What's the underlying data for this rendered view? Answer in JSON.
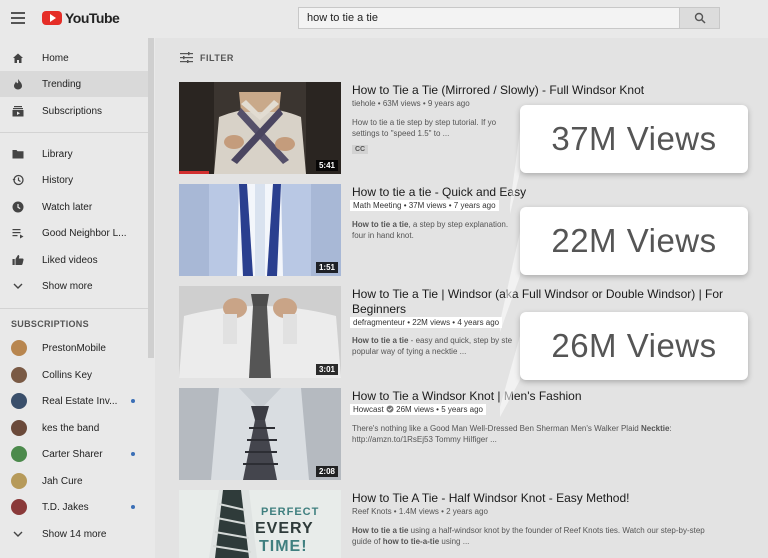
{
  "app": {
    "logo": "YouTube"
  },
  "search": {
    "query": "how to tie a tie"
  },
  "sidebar": {
    "items": [
      {
        "label": "Home",
        "icon": "home-icon"
      },
      {
        "label": "Trending",
        "icon": "trending-icon"
      },
      {
        "label": "Subscriptions",
        "icon": "subscriptions-icon"
      },
      {
        "label": "Library",
        "icon": "library-icon"
      },
      {
        "label": "History",
        "icon": "history-icon"
      },
      {
        "label": "Watch later",
        "icon": "watch-later-icon"
      },
      {
        "label": "Good Neighbor L...",
        "icon": "playlist-icon"
      },
      {
        "label": "Liked videos",
        "icon": "thumbs-up-icon"
      },
      {
        "label": "Show more",
        "icon": "chevron-down-icon"
      }
    ],
    "subscriptions_heading": "SUBSCRIPTIONS",
    "subscriptions": [
      {
        "name": "PrestonMobile",
        "color": "#b8864f",
        "new": false
      },
      {
        "name": "Collins Key",
        "color": "#7a5a45",
        "new": false
      },
      {
        "name": "Real Estate Inv...",
        "color": "#3a4f6b",
        "new": true
      },
      {
        "name": "kes the band",
        "color": "#6b4a3a",
        "new": false
      },
      {
        "name": "Carter Sharer",
        "color": "#4c8a4c",
        "new": true
      },
      {
        "name": "Jah Cure",
        "color": "#b69a5a",
        "new": false
      },
      {
        "name": "T.D. Jakes",
        "color": "#8a3a3a",
        "new": true
      }
    ],
    "show_more_subs": "Show 14 more"
  },
  "main": {
    "filter_label": "FILTER",
    "videos": [
      {
        "title": "How to Tie a Tie (Mirrored / Slowly) - Full Windsor Knot",
        "channel": "tiehole",
        "views": "63M views",
        "age": "9 years ago",
        "desc_line1": "How to tie a tie step by step tutorial. If yo",
        "desc_line2": "settings to \"speed 1.5\" to ...",
        "badge": "CC",
        "duration": "5:41"
      },
      {
        "title": "How to tie a tie - Quick and Easy",
        "channel": "Math Meeting",
        "views": "37M views",
        "age": "7 years ago",
        "desc_bold": "How to tie a tie",
        "desc_line1": ", a step by step explanation.",
        "desc_line2": "four in hand knot.",
        "duration": "1:51"
      },
      {
        "title": "How to Tie a Tie | Windsor (aka Full Windsor or Double Windsor) | For Beginners",
        "channel": "defragmenteur",
        "views": "22M views",
        "age": "4 years ago",
        "desc_bold": "How to tie a tie",
        "desc_line1": " - easy and quick, step by ste",
        "desc_line2": "popular way of tying a necktie ...",
        "duration": "3:01"
      },
      {
        "title": "How to Tie a Windsor Knot | Men's Fashion",
        "channel": "Howcast",
        "views": "26M views",
        "age": "5 years ago",
        "desc_line1": "There's nothing like a Good Man Well-Dressed Ben Sherman Men's Walker Plaid ",
        "desc_line1_bold": "Necktie",
        "desc_line2": "http://amzn.to/1RsEj53 Tommy Hilfiger ...",
        "duration": "2:08"
      },
      {
        "title": "How to Tie A Tie - Half Windsor Knot - Easy Method!",
        "channel": "Reef Knots",
        "views": "1.4M views",
        "age": "2 years ago",
        "desc_bold": "How to tie a tie",
        "desc_line1": " using a half-windsor knot by the founder of Reef Knots ties. Watch our step-by-step",
        "desc_line2a": "guide of ",
        "desc_line2_bold": "how to tie-a-tie",
        "desc_line2b": " using ...",
        "thumb_text1": "PERFECT",
        "thumb_text2": "EVERY",
        "thumb_text3": "TIME!"
      }
    ]
  },
  "callouts": [
    {
      "text": "37M Views"
    },
    {
      "text": "22M Views"
    },
    {
      "text": "26M Views"
    }
  ]
}
